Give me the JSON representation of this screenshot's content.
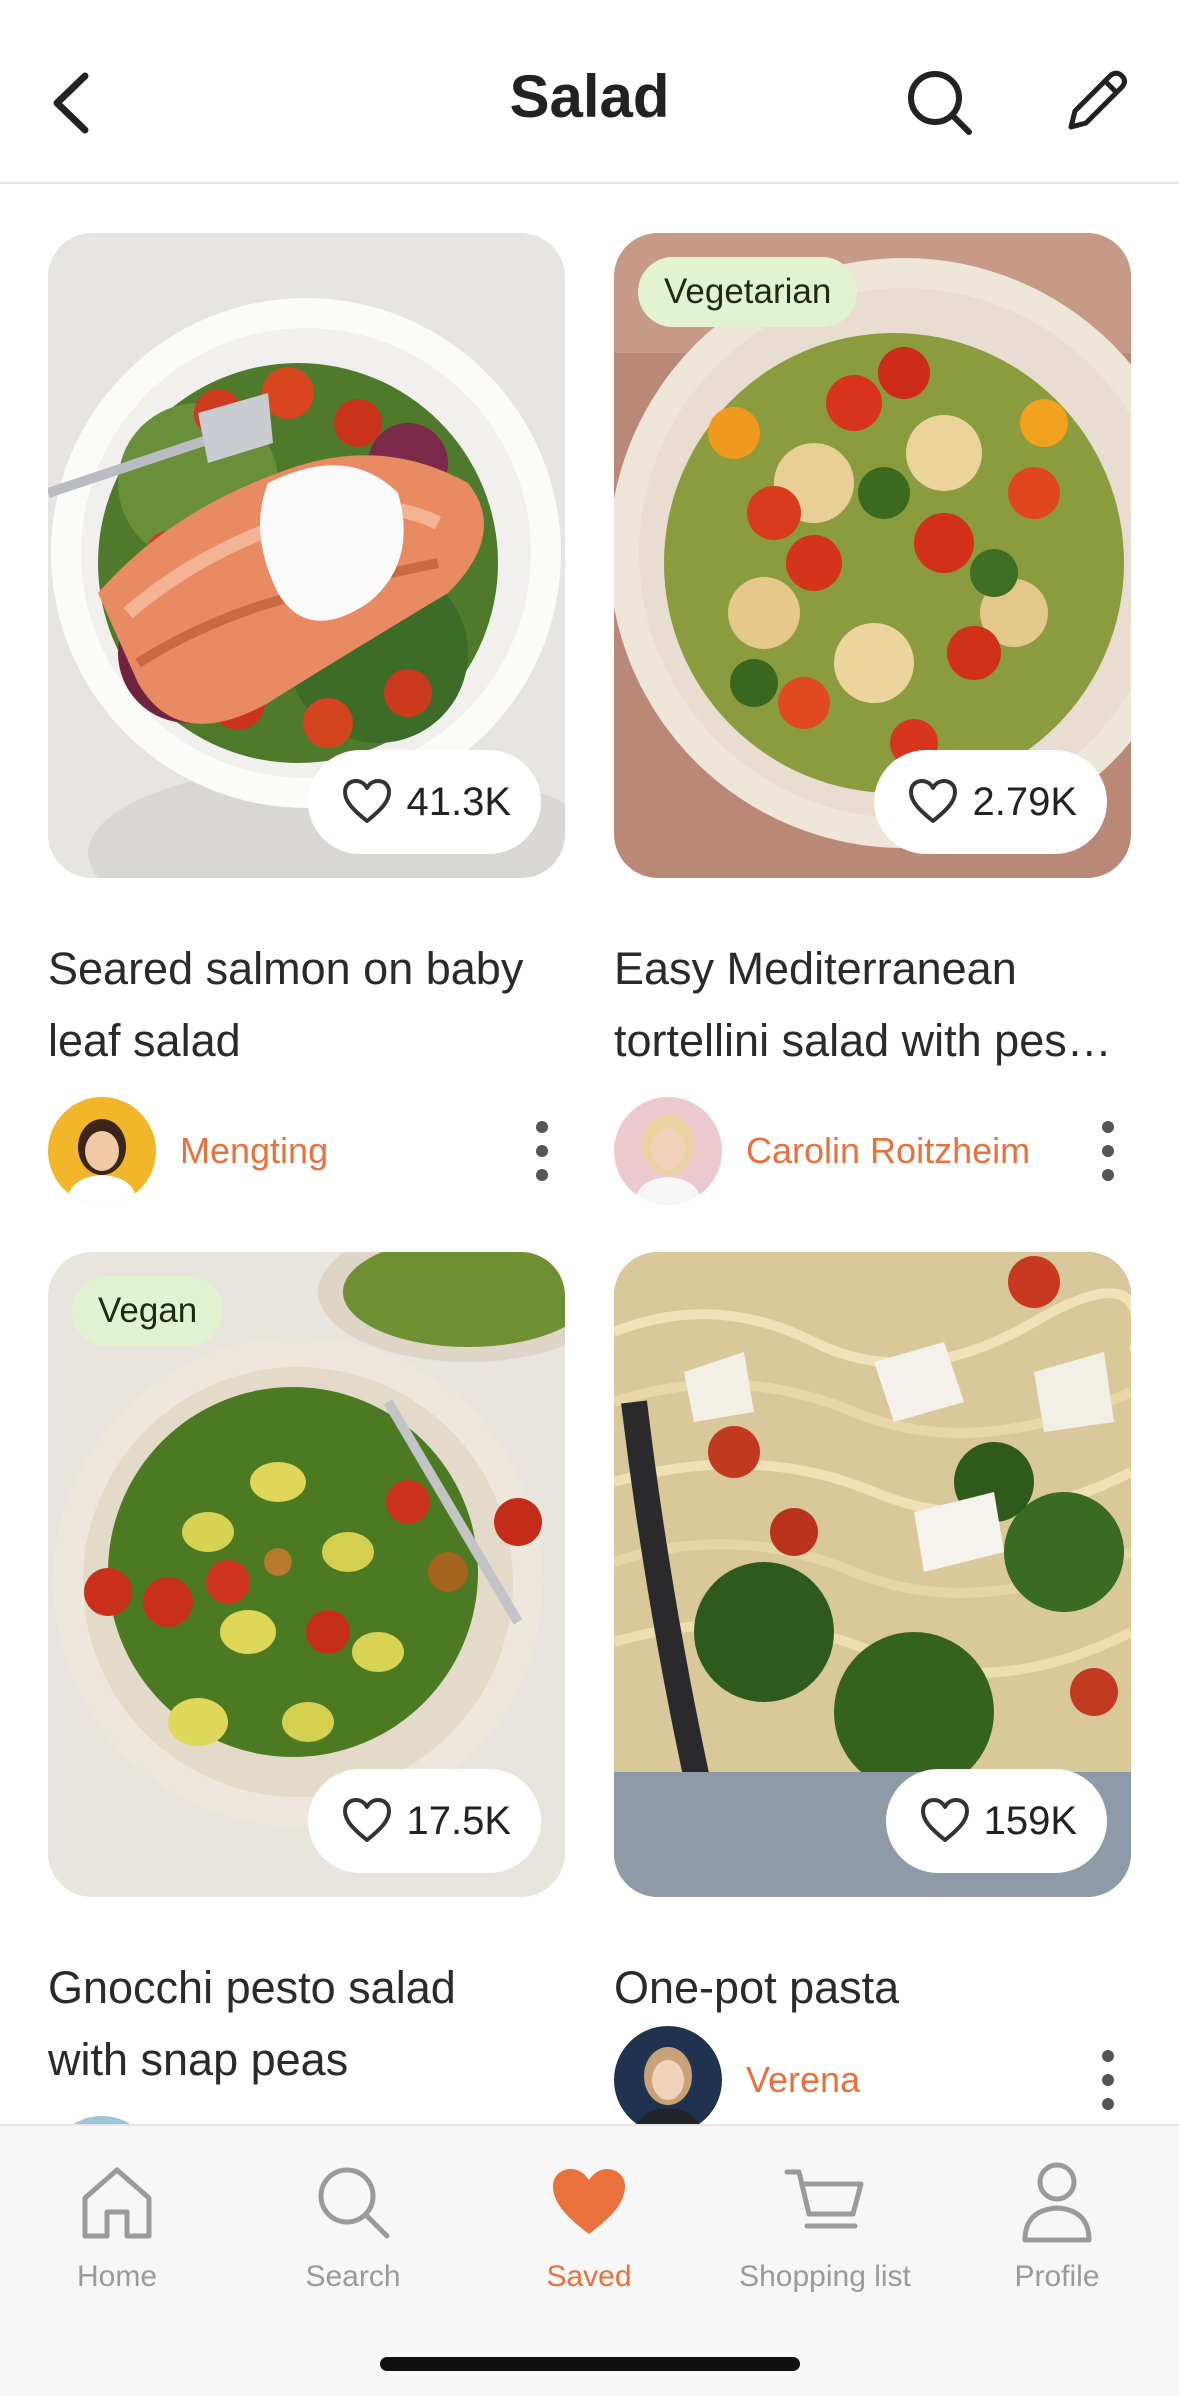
{
  "header": {
    "title": "Salad",
    "back_icon": "chevron-left-icon",
    "search_icon": "search-icon",
    "edit_icon": "pencil-icon"
  },
  "recipes": [
    {
      "title_line1": "Seared salmon on baby",
      "title_line2": "leaf salad",
      "likes": "41.3K",
      "tag": "",
      "author": "Mengting"
    },
    {
      "title_line1": "Easy Mediterranean",
      "title_line2": "tortellini salad with pes…",
      "likes": "2.79K",
      "tag": "Vegetarian",
      "author": "Carolin Roitzheim"
    },
    {
      "title_line1": "Gnocchi pesto salad",
      "title_line2": "with snap peas",
      "likes": "17.5K",
      "tag": "Vegan",
      "author": ""
    },
    {
      "title_line1": "One-pot pasta",
      "title_line2": "",
      "likes": "159K",
      "tag": "",
      "author": "Verena"
    }
  ],
  "tabbar": {
    "items": [
      {
        "label": "Home",
        "icon": "home-icon"
      },
      {
        "label": "Search",
        "icon": "search-icon"
      },
      {
        "label": "Saved",
        "icon": "heart-icon",
        "active": true
      },
      {
        "label": "Shopping list",
        "icon": "cart-icon"
      },
      {
        "label": "Profile",
        "icon": "person-icon"
      }
    ]
  },
  "colors": {
    "accent": "#e8713c",
    "tag_bg": "#e3f3d2",
    "text": "#222222"
  }
}
